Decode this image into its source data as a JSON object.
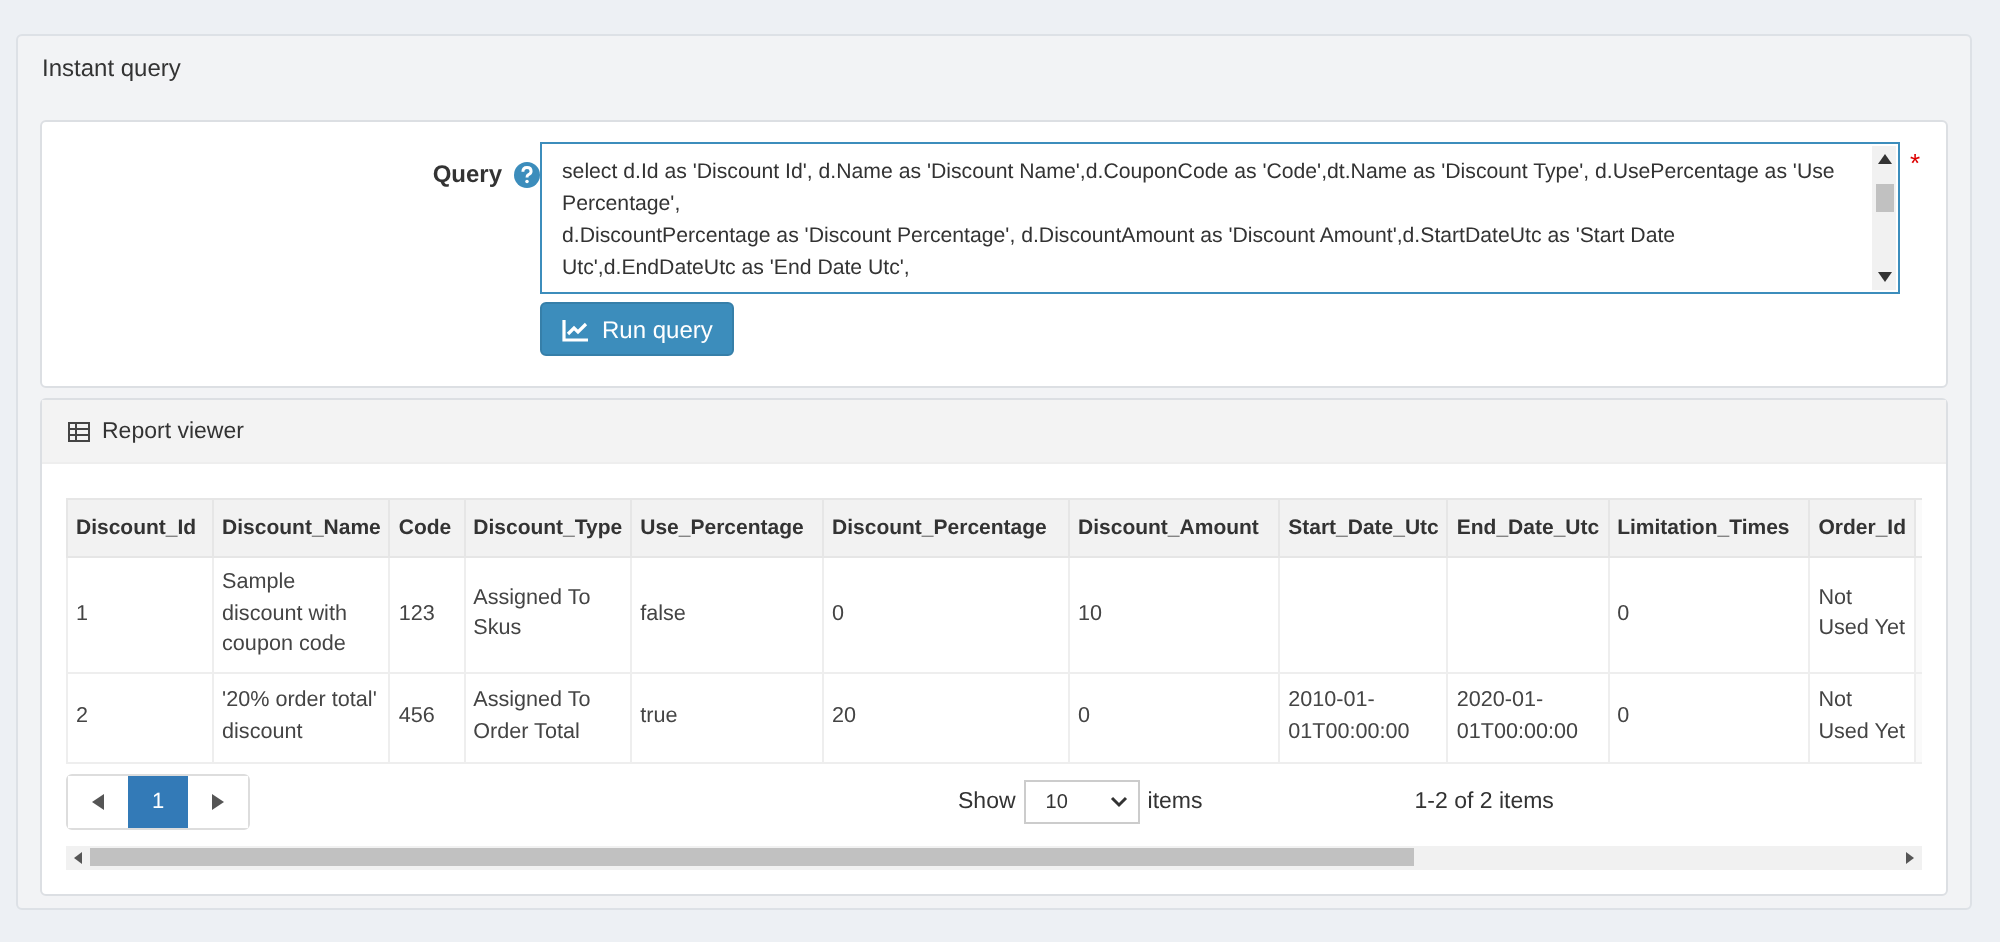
{
  "panel": {
    "title": "Instant query"
  },
  "query": {
    "label": "Query",
    "required_mark": "*",
    "value": "select d.Id as 'Discount Id', d.Name as 'Discount Name',d.CouponCode as 'Code',dt.Name as 'Discount Type', d.UsePercentage as 'Use Percentage',\nd.DiscountPercentage as 'Discount Percentage', d.DiscountAmount as 'Discount Amount',d.StartDateUtc as 'Start Date Utc',d.EndDateUtc as 'End Date Utc',",
    "run_button": "Run query"
  },
  "report": {
    "title": "Report viewer",
    "table": {
      "columns": [
        "Discount_Id",
        "Discount_Name",
        "Code",
        "Discount_Type",
        "Use_Percentage",
        "Discount_Percentage",
        "Discount_Amount",
        "Start_Date_Utc",
        "End_Date_Utc",
        "Limitation_Times",
        "Order_Id"
      ],
      "rows": [
        [
          "1",
          "Sample discount with coupon code",
          "123",
          "Assigned To Skus",
          "false",
          "0",
          "10",
          "",
          "",
          "0",
          "Not Used Yet"
        ],
        [
          "2",
          "'20% order total' discount",
          "456",
          "Assigned To Order Total",
          "true",
          "20",
          "0",
          "2010-01-01T00:00:00",
          "2020-01-01T00:00:00",
          "0",
          "Not Used Yet"
        ]
      ]
    },
    "pager": {
      "pages": [
        {
          "label": "1",
          "selected": true
        }
      ],
      "show_label": "Show",
      "page_size": "10",
      "items_label": "items",
      "summary": "1-2 of 2 items"
    }
  }
}
